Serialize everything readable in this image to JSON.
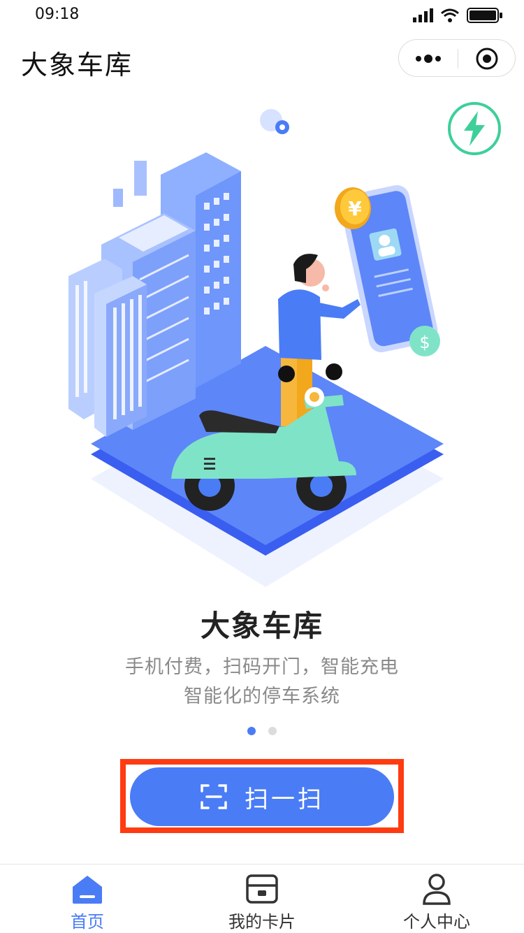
{
  "status_bar": {
    "time": "09:18"
  },
  "nav": {
    "title": "大象车库"
  },
  "hero": {
    "title": "大象车库",
    "subtitle_line1": "手机付费，扫码开门，智能充电",
    "subtitle_line2": "智能化的停车系统",
    "coin_symbol": "¥",
    "dollar_symbol": "$"
  },
  "carousel": {
    "total": 2,
    "active_index": 0
  },
  "scan_button": {
    "label": "扫一扫"
  },
  "tabbar": {
    "tabs": [
      {
        "label": "首页",
        "icon": "home-icon",
        "active": true
      },
      {
        "label": "我的卡片",
        "icon": "card-icon",
        "active": false
      },
      {
        "label": "个人中心",
        "icon": "user-icon",
        "active": false
      }
    ]
  },
  "colors": {
    "primary": "#4a7cf6",
    "highlight": "#ff3b12",
    "charge": "#3ecf9a",
    "scooter": "#7fe3c8"
  }
}
